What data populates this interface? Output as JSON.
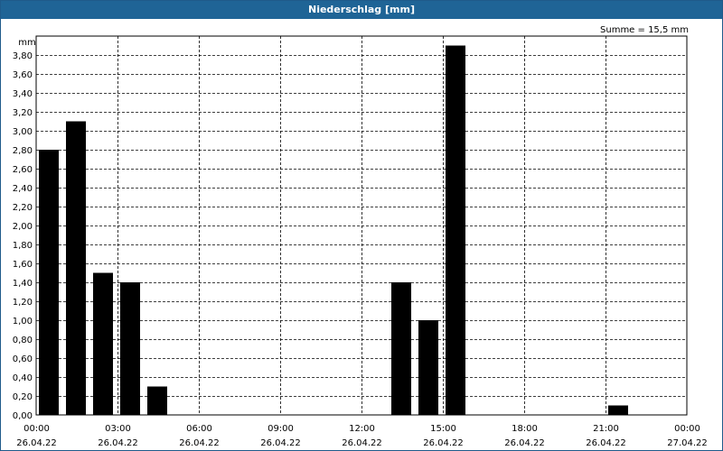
{
  "window": {
    "title": "Niederschlag [mm]"
  },
  "chart_data": {
    "type": "bar",
    "title": "Niederschlag [mm]",
    "annotation": "Summe = 15,5 mm",
    "ylabel": "mm",
    "ylim": [
      0,
      4.0
    ],
    "yticks": [
      "0,00",
      "0,20",
      "0,40",
      "0,60",
      "0,80",
      "1,00",
      "1,20",
      "1,40",
      "1,60",
      "1,80",
      "2,00",
      "2,20",
      "2,40",
      "2,60",
      "2,80",
      "3,00",
      "3,20",
      "3,40",
      "3,60",
      "3,80"
    ],
    "xlim_hours": [
      0,
      24
    ],
    "xticks": [
      {
        "time": "00:00",
        "date": "26.04.22"
      },
      {
        "time": "03:00",
        "date": "26.04.22"
      },
      {
        "time": "06:00",
        "date": "26.04.22"
      },
      {
        "time": "09:00",
        "date": "26.04.22"
      },
      {
        "time": "12:00",
        "date": "26.04.22"
      },
      {
        "time": "15:00",
        "date": "26.04.22"
      },
      {
        "time": "18:00",
        "date": "26.04.22"
      },
      {
        "time": "21:00",
        "date": "26.04.22"
      },
      {
        "time": "00:00",
        "date": "27.04.22"
      }
    ],
    "categories": [
      "00:00",
      "01:00",
      "02:00",
      "03:00",
      "04:00",
      "05:00",
      "06:00",
      "07:00",
      "08:00",
      "09:00",
      "10:00",
      "11:00",
      "12:00",
      "13:00",
      "14:00",
      "15:00",
      "16:00",
      "17:00",
      "18:00",
      "19:00",
      "20:00",
      "21:00",
      "22:00",
      "23:00"
    ],
    "values": [
      2.8,
      3.1,
      1.5,
      1.4,
      0.3,
      0,
      0,
      0,
      0,
      0,
      0,
      0,
      0,
      1.4,
      1.0,
      3.9,
      0,
      0,
      0,
      0,
      0,
      0.1,
      0,
      0
    ],
    "grid": true,
    "colors": {
      "bar": "#000000",
      "grid": "#000000",
      "title_bg": "#1f6496"
    }
  }
}
